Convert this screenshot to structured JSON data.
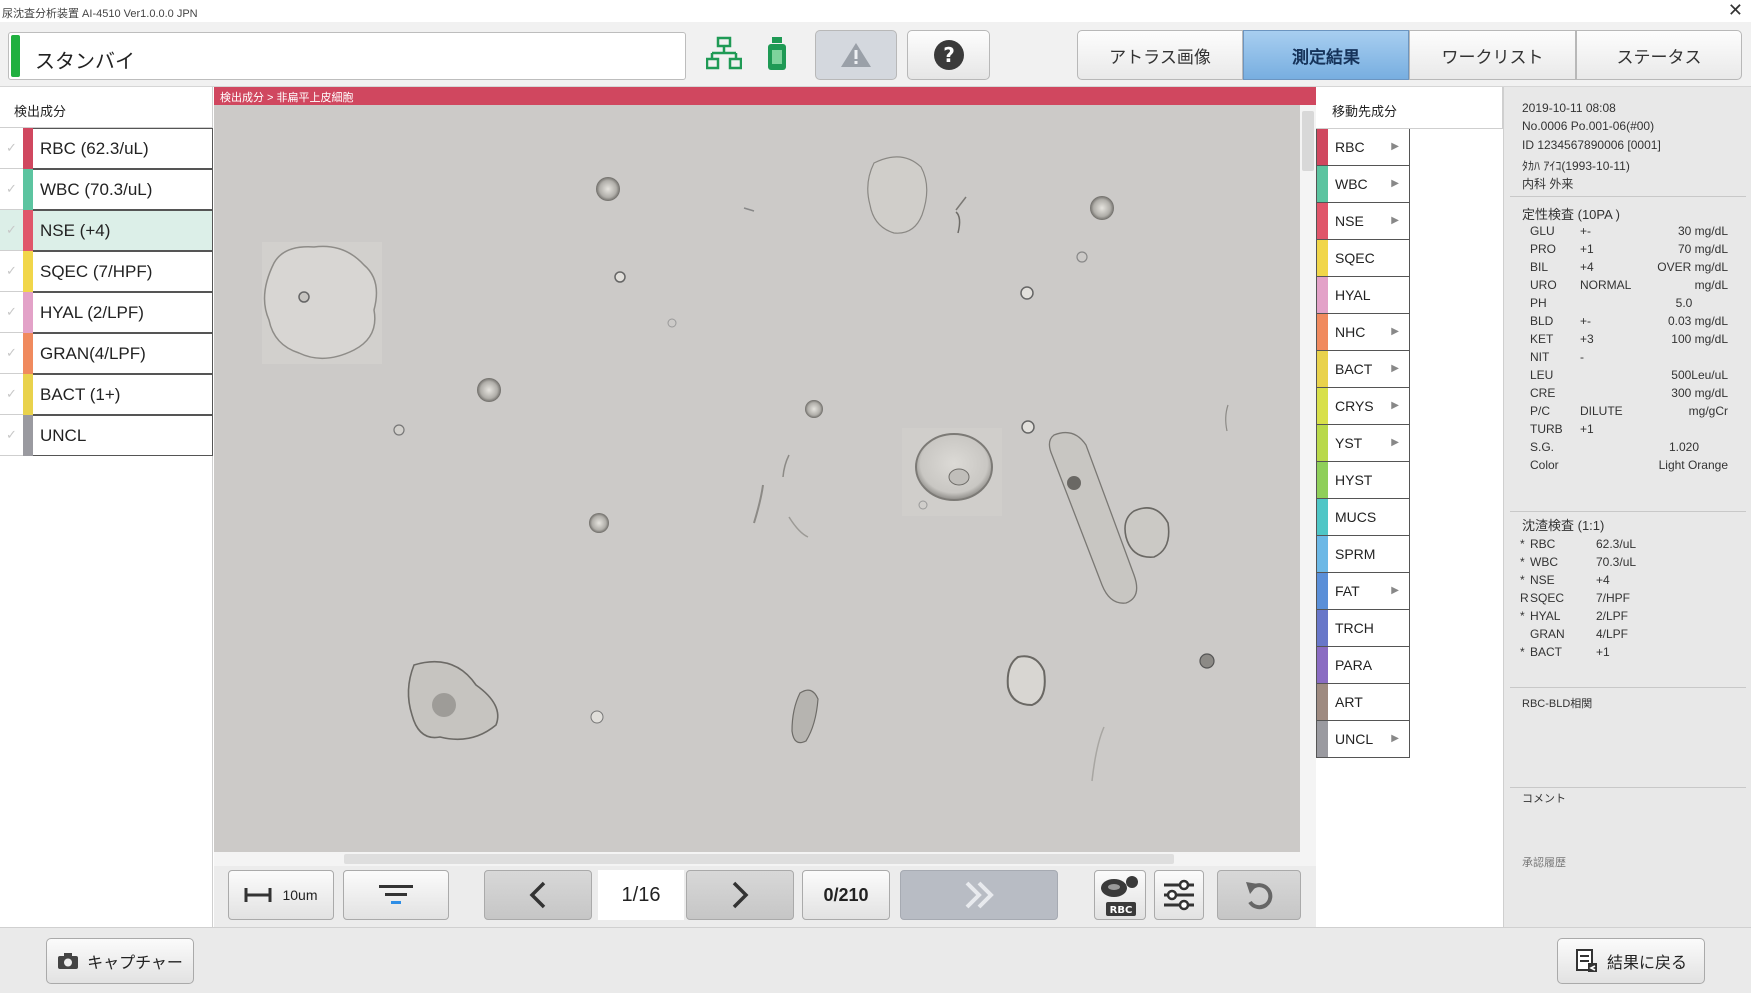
{
  "window": {
    "title": "尿沈査分析装置 AI-4510  Ver1.0.0.0 JPN",
    "close_glyph": "✕"
  },
  "header": {
    "status_text": "スタンバイ",
    "tabs": [
      {
        "label": "アトラス画像",
        "active": false
      },
      {
        "label": "測定結果",
        "active": true
      },
      {
        "label": "ワークリスト",
        "active": false
      },
      {
        "label": "ステータス",
        "active": false
      }
    ],
    "icons": [
      "network-icon",
      "reagent-bottle-icon",
      "warning-icon",
      "help-icon"
    ]
  },
  "breadcrumb": "検出成分 >  非扁平上皮細胞",
  "detected": {
    "header": "検出成分",
    "items": [
      {
        "label": "RBC (62.3/uL)",
        "color": "#d0475f",
        "selected": false
      },
      {
        "label": "WBC (70.3/uL)",
        "color": "#5cc4a0",
        "selected": false
      },
      {
        "label": "NSE (+4)",
        "color": "#e0566a",
        "selected": true
      },
      {
        "label": "SQEC (7/HPF)",
        "color": "#f1d64a",
        "selected": false
      },
      {
        "label": "HYAL (2/LPF)",
        "color": "#e3a2c8",
        "selected": false
      },
      {
        "label": "GRAN(4/LPF)",
        "color": "#f08a5e",
        "selected": false
      },
      {
        "label": "BACT (1+)",
        "color": "#e9d24c",
        "selected": false
      },
      {
        "label": "UNCL",
        "color": "#9a9aa0",
        "selected": false
      }
    ]
  },
  "controls": {
    "scale_label": "10um",
    "page": "1/16",
    "count": "0/210",
    "rbc_badge": "RBC"
  },
  "destination": {
    "header": "移動先成分",
    "items": [
      {
        "label": "RBC",
        "color": "#d0475f",
        "arrow": true
      },
      {
        "label": "WBC",
        "color": "#5cc4a0",
        "arrow": true
      },
      {
        "label": "NSE",
        "color": "#e0566a",
        "arrow": true
      },
      {
        "label": "SQEC",
        "color": "#f1d64a",
        "arrow": false
      },
      {
        "label": "HYAL",
        "color": "#e3a2c8",
        "arrow": false
      },
      {
        "label": "NHC",
        "color": "#f08a5e",
        "arrow": true
      },
      {
        "label": "BACT",
        "color": "#e9d24c",
        "arrow": true
      },
      {
        "label": "CRYS",
        "color": "#d8e04a",
        "arrow": true
      },
      {
        "label": "YST",
        "color": "#b9d94a",
        "arrow": true
      },
      {
        "label": "HYST",
        "color": "#8fcf5a",
        "arrow": false
      },
      {
        "label": "MUCS",
        "color": "#4fc6c6",
        "arrow": false
      },
      {
        "label": "SPRM",
        "color": "#6cb8e6",
        "arrow": false
      },
      {
        "label": "FAT",
        "color": "#5a8fd8",
        "arrow": true
      },
      {
        "label": "TRCH",
        "color": "#6877c9",
        "arrow": false
      },
      {
        "label": "PARA",
        "color": "#8a6cc2",
        "arrow": false
      },
      {
        "label": "ART",
        "color": "#9e8a80",
        "arrow": false
      },
      {
        "label": "UNCL",
        "color": "#9a9aa0",
        "arrow": true
      }
    ]
  },
  "patient": {
    "datetime": "2019-10-11 08:08",
    "sample_no": "No.0006 Po.001-06(#00)",
    "id": "ID 1234567890006 [0001]",
    "name": "ﾀｶﾊ ｱｲｺ(1993-10-11)",
    "dept": "内科 外来"
  },
  "qualitative": {
    "title": "定性検査 (10PA )",
    "rows": [
      {
        "name": "GLU",
        "result": "+-",
        "value": "30 mg/dL"
      },
      {
        "name": "PRO",
        "result": "+1",
        "value": "70 mg/dL"
      },
      {
        "name": "BIL",
        "result": "+4",
        "value": "OVER mg/dL"
      },
      {
        "name": "URO",
        "result": "NORMAL",
        "value": "mg/dL"
      },
      {
        "name": "PH",
        "result": "",
        "value": "5.0",
        "center": true
      },
      {
        "name": "BLD",
        "result": "+-",
        "value": "0.03 mg/dL"
      },
      {
        "name": "KET",
        "result": "+3",
        "value": "100 mg/dL"
      },
      {
        "name": "NIT",
        "result": "-",
        "value": ""
      },
      {
        "name": "LEU",
        "result": "",
        "value": "500Leu/uL"
      },
      {
        "name": "CRE",
        "result": "",
        "value": "300 mg/dL"
      },
      {
        "name": "P/C",
        "result": "DILUTE",
        "value": "mg/gCr"
      },
      {
        "name": "TURB",
        "result": "+1",
        "value": ""
      },
      {
        "name": "S.G.",
        "result": "",
        "value": "1.020",
        "center": true
      },
      {
        "name": "Color",
        "result": "",
        "value": "Light Orange"
      }
    ]
  },
  "sediment": {
    "title": "沈渣検査 (1:1)",
    "rows": [
      {
        "mark": "*",
        "name": "RBC",
        "value": "62.3/uL"
      },
      {
        "mark": "*",
        "name": "WBC",
        "value": "70.3/uL"
      },
      {
        "mark": "*",
        "name": "NSE",
        "value": "+4"
      },
      {
        "mark": "R",
        "name": "SQEC",
        "value": "7/HPF"
      },
      {
        "mark": "*",
        "name": "HYAL",
        "value": "2/LPF"
      },
      {
        "mark": "",
        "name": "GRAN",
        "value": "4/LPF"
      },
      {
        "mark": "*",
        "name": "BACT",
        "value": "+1"
      }
    ]
  },
  "sections": {
    "rbc_bld": "RBC-BLD相関",
    "comment": "コメント",
    "approval": "承認履歴"
  },
  "footer": {
    "capture_label": "キャプチャー",
    "back_label": "結果に戻る"
  }
}
